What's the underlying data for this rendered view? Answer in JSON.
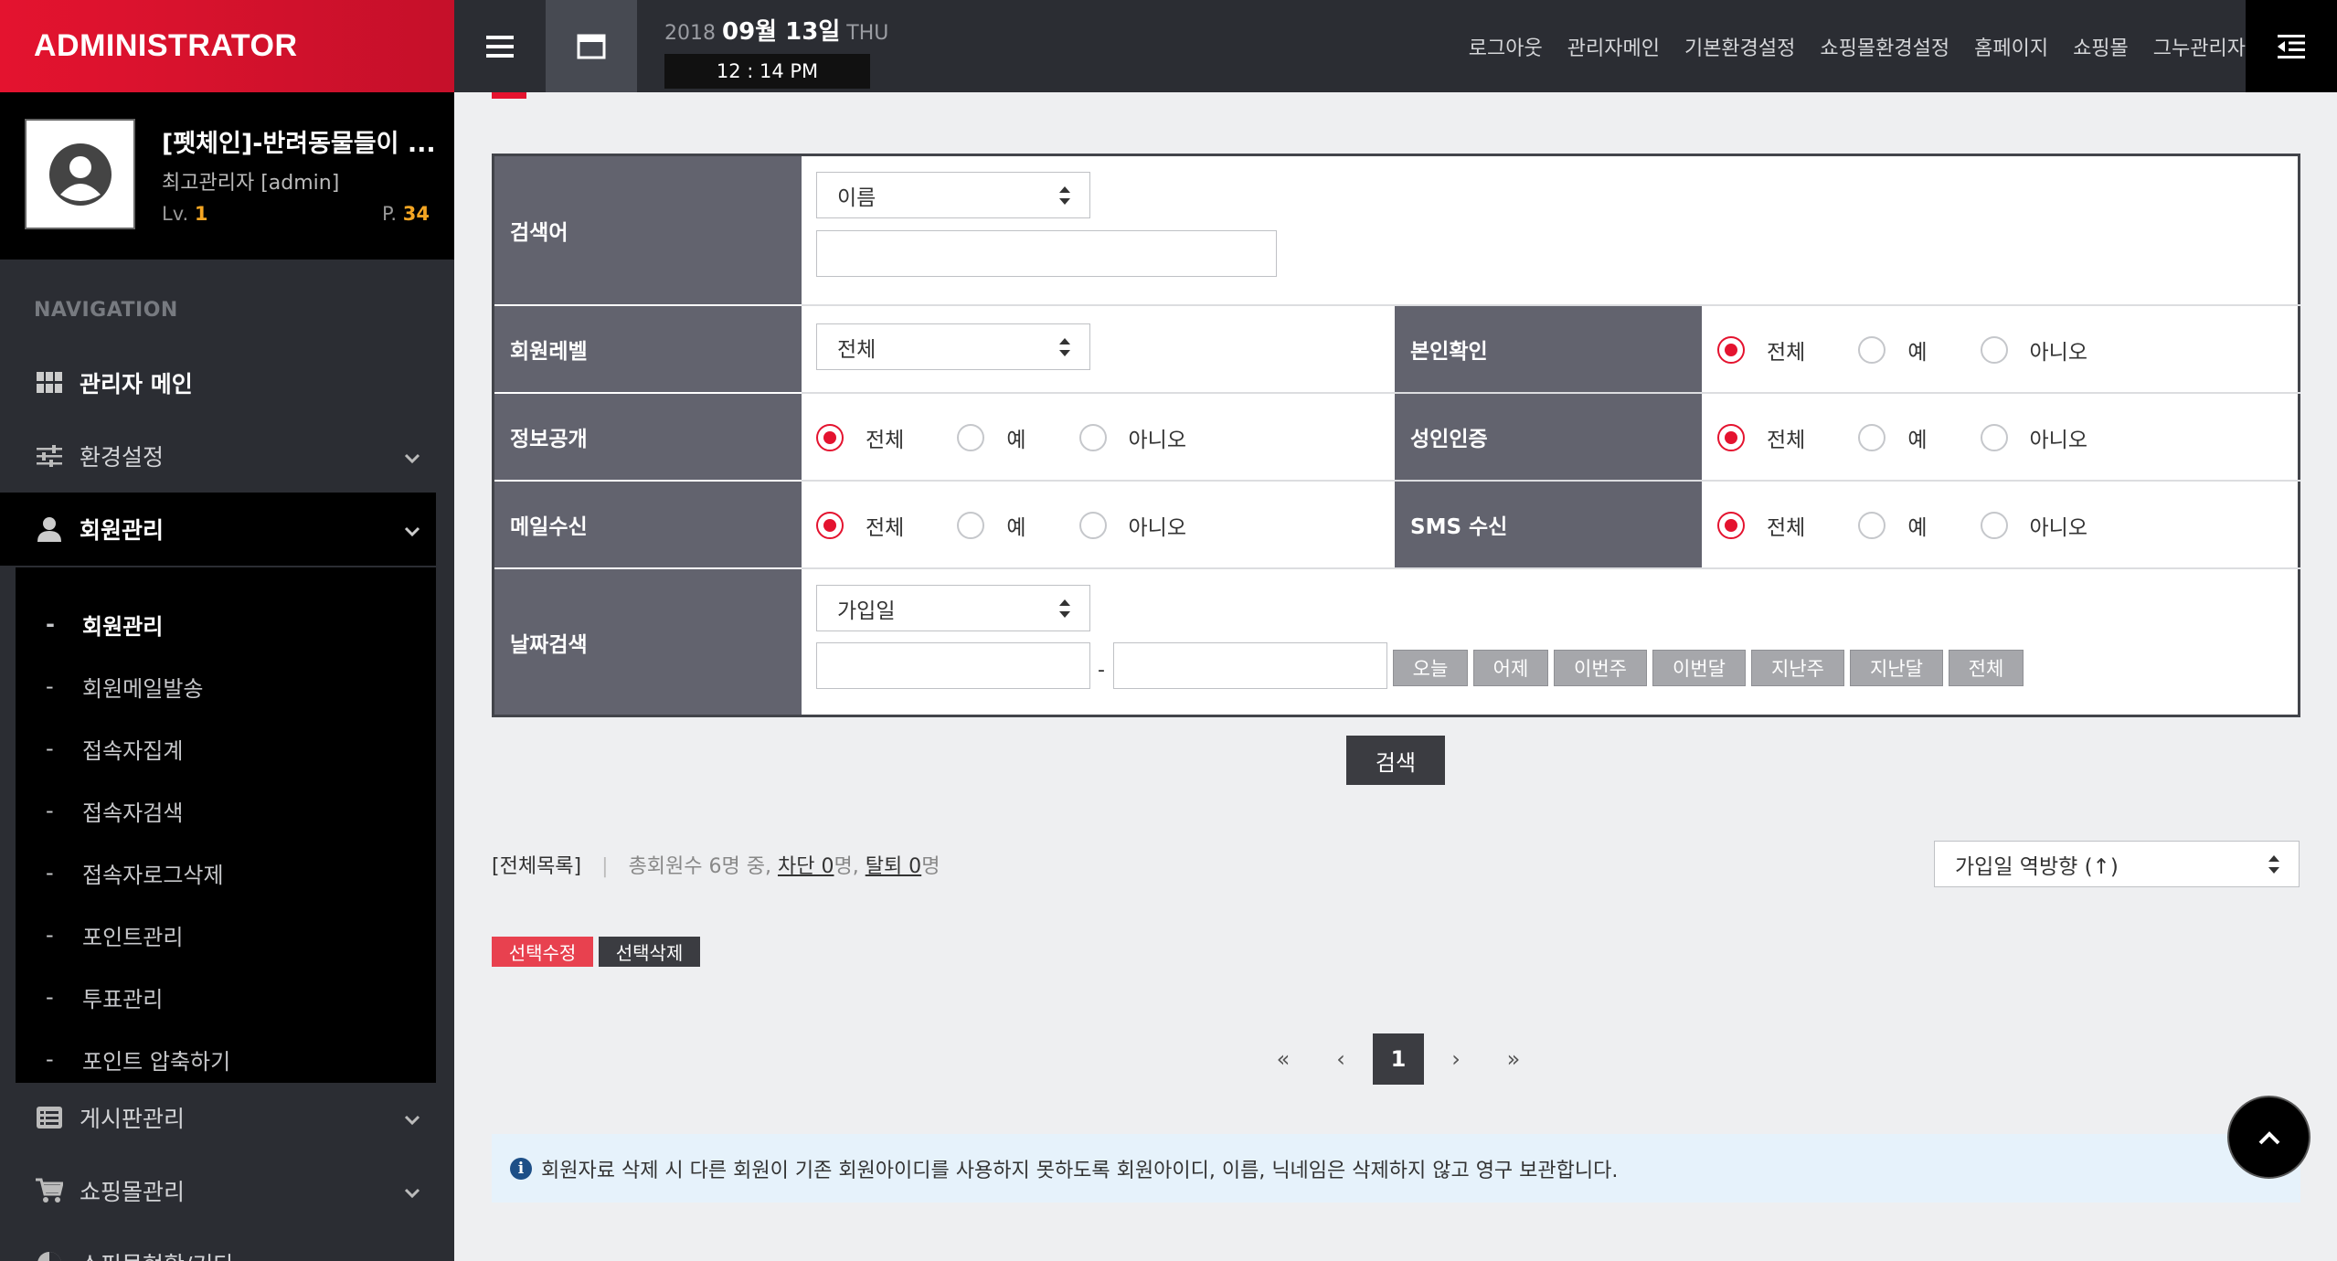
{
  "topbar": {
    "brand": "ADMINISTRATOR",
    "date_year": "2018",
    "date_monthday": "09월 13일",
    "date_weekday": "THU",
    "time": "12 : 14 PM",
    "links": [
      "로그아웃",
      "관리자메인",
      "기본환경설정",
      "쇼핑몰환경설정",
      "홈페이지",
      "쇼핑몰",
      "그누관리자"
    ]
  },
  "profile": {
    "name": "[펫체인]-반려동물들이 ...",
    "role": "최고관리자 [admin]",
    "level_label": "Lv.",
    "level_value": "1",
    "point_label": "P.",
    "point_value": "34"
  },
  "sidebar": {
    "heading": "NAVIGATION",
    "items": [
      {
        "label": "관리자 메인",
        "icon": "dashboard-grid-icon"
      },
      {
        "label": "환경설정",
        "icon": "sliders-icon"
      },
      {
        "label": "회원관리",
        "icon": "user-icon"
      },
      {
        "label": "게시판관리",
        "icon": "list-box-icon"
      },
      {
        "label": "쇼핑몰관리",
        "icon": "cart-icon"
      },
      {
        "label": "쇼핑몰현황/기타",
        "icon": "pie-chart-icon"
      }
    ],
    "subitems": [
      "회원관리",
      "회원메일발송",
      "접속자집계",
      "접속자검색",
      "접속자로그삭제",
      "포인트관리",
      "투표관리",
      "포인트 압축하기"
    ],
    "dash": "-"
  },
  "search_form": {
    "keyword_label": "검색어",
    "keyword_field": "이름",
    "level_label": "회원레벨",
    "level_value": "전체",
    "verify_label": "본인확인",
    "info_label": "정보공개",
    "adult_label": "성인인증",
    "mail_label": "메일수신",
    "sms_label": "SMS 수신",
    "date_label": "날짜검색",
    "date_field": "가입일",
    "date_separator": "-",
    "radio_options": [
      "전체",
      "예",
      "아니오"
    ],
    "date_buttons": [
      "오늘",
      "어제",
      "이번주",
      "이번달",
      "지난주",
      "지난달",
      "전체"
    ],
    "submit": "검색"
  },
  "list": {
    "all_list": "[전체목록]",
    "sep": "|",
    "total_text": "총회원수 6명 중,",
    "blocked_label": "차단 0",
    "blocked_suffix": "명,",
    "left_label": "탈퇴 0",
    "left_suffix": "명",
    "sort_value": "가입일 역방향 (↑)",
    "btn_edit": "선택수정",
    "btn_delete": "선택삭제"
  },
  "pagination": {
    "first": "«",
    "prev": "‹",
    "current": "1",
    "next": "›",
    "last": "»"
  },
  "notice": {
    "icon": "i",
    "text": "회원자료 삭제 시 다른 회원이 기존 회원아이디를 사용하지 못하도록 회원아이디, 이름, 닉네임은 삭제하지 않고 영구 보관합니다."
  },
  "colors": {
    "brand_red": "#e4132f",
    "dark_bar": "#2b2d33",
    "label_gray": "#62636e",
    "notice_bg": "#e6f2fb"
  }
}
